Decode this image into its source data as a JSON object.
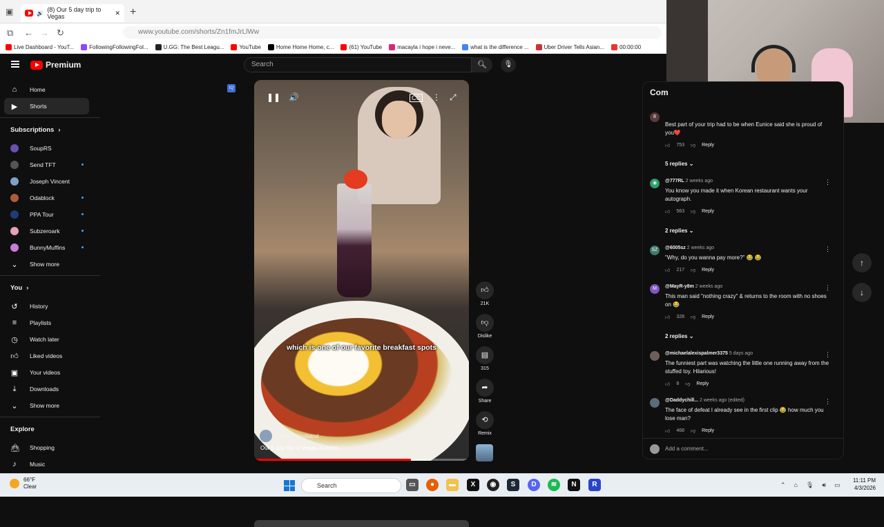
{
  "browser": {
    "tab_title": "(8) Our 5 day trip to Vegas",
    "url": "www.youtube.com/shorts/Zn1fmJrLlWw",
    "bookmarks": [
      "Live Dashboard - YouT...",
      "FollowingFollowingFol...",
      "U.GG: The Best Leagu...",
      "YouTube",
      "Home Home Home, c...",
      "(61) YouTube",
      "macayla i hope i neve...",
      "what is the difference ...",
      "Uber Driver Tells Asian...",
      "00:00:00"
    ]
  },
  "youtube": {
    "logo_text": "Premium",
    "search_placeholder": "Search",
    "nav": [
      "Home",
      "Shorts"
    ],
    "subscriptions_label": "Subscriptions",
    "subscriptions": [
      "SoupRS",
      "Send TFT",
      "Joseph Vincent",
      "Odablock",
      "PPA Tour",
      "Subzeroark",
      "BunnyMuffins"
    ],
    "show_more": "Show more",
    "you_label": "You",
    "you_items": [
      "History",
      "Playlists",
      "Watch later",
      "Liked videos",
      "Your videos",
      "Downloads"
    ],
    "explore_label": "Explore",
    "explore_items": [
      "Shopping",
      "Music"
    ]
  },
  "video": {
    "caption": "which is one of our favorite breakfast spots",
    "channel": "@POV_Husband",
    "title": "Our 5 day trip to Vegas in 2mins",
    "progress": 0.73,
    "actions": {
      "likes": "21K",
      "dislike": "Dislike",
      "comments": "315",
      "share": "Share",
      "remix": "Remix"
    }
  },
  "comments": {
    "header": "Com",
    "items": [
      {
        "author": "",
        "time": "",
        "text": "Best part of your trip had to be when Eunice said she is proud of you❤️",
        "likes": "753",
        "reply": "Reply",
        "replies": "5 replies"
      },
      {
        "author": "@777RL",
        "time": "2 weeks ago",
        "text": "You know you made it when Korean restaurant wants your autograph.",
        "likes": "563",
        "reply": "Reply",
        "replies": "2 replies"
      },
      {
        "author": "@6005sz",
        "time": "2 weeks ago",
        "text": "\"Why, do you wanna pay more?\" 😂 😂",
        "likes": "217",
        "reply": "Reply",
        "replies": ""
      },
      {
        "author": "@MayR-y8m",
        "time": "2 weeks ago",
        "text": "This man said \"nothing crazy\" & returns to the room with no shoes on 😂",
        "likes": "328",
        "reply": "Reply",
        "replies": "2 replies"
      },
      {
        "author": "@michaelalexispalmer3375",
        "time": "5 days ago",
        "text": "The funniest part was watching the little one running away from the stuffed toy. Hilarious!",
        "likes": "8",
        "reply": "Reply",
        "replies": ""
      },
      {
        "author": "@Daddychill...",
        "time": "2 weeks ago (edited)",
        "text": "The face of defeat I already see in the first clip 😂 how much you lose man?",
        "likes": "468",
        "reply": "Reply",
        "replies": ""
      }
    ],
    "add_placeholder": "Add a comment..."
  },
  "taskbar": {
    "weather_temp": "66°F",
    "weather_desc": "Clear",
    "weather_badge": "2",
    "search_label": "Search",
    "time": "11:11 PM",
    "date": "4/3/2026"
  },
  "colors": {
    "accent_red": "#ff0000",
    "link_blue": "#3ea6ff"
  }
}
